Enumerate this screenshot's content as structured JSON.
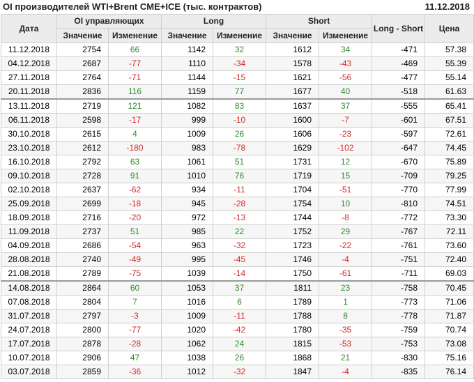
{
  "header": {
    "title": "OI производителей WTI+Brent CME+ICE (тыс. контрактов)",
    "date": "11.12.2018"
  },
  "columns": {
    "date": "Дата",
    "oi_group": "OI управляющих",
    "long_group": "Long",
    "short_group": "Short",
    "long_short": "Long - Short",
    "price": "Цена",
    "value": "Значение",
    "change": "Изменение"
  },
  "colors": {
    "positive": "#2e8b2e",
    "negative": "#d42a2a",
    "header_bg": "#ececec"
  },
  "rows": [
    {
      "date": "11.12.2018",
      "oi": "2754",
      "oi_chg": "66",
      "long": "1142",
      "long_chg": "32",
      "short": "1612",
      "short_chg": "34",
      "ls": "-471",
      "price": "57.38"
    },
    {
      "date": "04.12.2018",
      "oi": "2687",
      "oi_chg": "-77",
      "long": "1110",
      "long_chg": "-34",
      "short": "1578",
      "short_chg": "-43",
      "ls": "-469",
      "price": "55.39"
    },
    {
      "date": "27.11.2018",
      "oi": "2764",
      "oi_chg": "-71",
      "long": "1144",
      "long_chg": "-15",
      "short": "1621",
      "short_chg": "-56",
      "ls": "-477",
      "price": "55.14"
    },
    {
      "date": "20.11.2018",
      "oi": "2836",
      "oi_chg": "116",
      "long": "1159",
      "long_chg": "77",
      "short": "1677",
      "short_chg": "40",
      "ls": "-518",
      "price": "61.63"
    },
    {
      "date": "13.11.2018",
      "oi": "2719",
      "oi_chg": "121",
      "long": "1082",
      "long_chg": "83",
      "short": "1637",
      "short_chg": "37",
      "ls": "-555",
      "price": "65.41"
    },
    {
      "date": "06.11.2018",
      "oi": "2598",
      "oi_chg": "-17",
      "long": "999",
      "long_chg": "-10",
      "short": "1600",
      "short_chg": "-7",
      "ls": "-601",
      "price": "67.51"
    },
    {
      "date": "30.10.2018",
      "oi": "2615",
      "oi_chg": "4",
      "long": "1009",
      "long_chg": "26",
      "short": "1606",
      "short_chg": "-23",
      "ls": "-597",
      "price": "72.61"
    },
    {
      "date": "23.10.2018",
      "oi": "2612",
      "oi_chg": "-180",
      "long": "983",
      "long_chg": "-78",
      "short": "1629",
      "short_chg": "-102",
      "ls": "-647",
      "price": "74.45"
    },
    {
      "date": "16.10.2018",
      "oi": "2792",
      "oi_chg": "63",
      "long": "1061",
      "long_chg": "51",
      "short": "1731",
      "short_chg": "12",
      "ls": "-670",
      "price": "75.89"
    },
    {
      "date": "09.10.2018",
      "oi": "2728",
      "oi_chg": "91",
      "long": "1010",
      "long_chg": "76",
      "short": "1719",
      "short_chg": "15",
      "ls": "-709",
      "price": "79.25"
    },
    {
      "date": "02.10.2018",
      "oi": "2637",
      "oi_chg": "-62",
      "long": "934",
      "long_chg": "-11",
      "short": "1704",
      "short_chg": "-51",
      "ls": "-770",
      "price": "77.99"
    },
    {
      "date": "25.09.2018",
      "oi": "2699",
      "oi_chg": "-18",
      "long": "945",
      "long_chg": "-28",
      "short": "1754",
      "short_chg": "10",
      "ls": "-810",
      "price": "74.51"
    },
    {
      "date": "18.09.2018",
      "oi": "2716",
      "oi_chg": "-20",
      "long": "972",
      "long_chg": "-13",
      "short": "1744",
      "short_chg": "-8",
      "ls": "-772",
      "price": "73.30"
    },
    {
      "date": "11.09.2018",
      "oi": "2737",
      "oi_chg": "51",
      "long": "985",
      "long_chg": "22",
      "short": "1752",
      "short_chg": "29",
      "ls": "-767",
      "price": "72.11"
    },
    {
      "date": "04.09.2018",
      "oi": "2686",
      "oi_chg": "-54",
      "long": "963",
      "long_chg": "-32",
      "short": "1723",
      "short_chg": "-22",
      "ls": "-761",
      "price": "73.60"
    },
    {
      "date": "28.08.2018",
      "oi": "2740",
      "oi_chg": "-49",
      "long": "995",
      "long_chg": "-45",
      "short": "1746",
      "short_chg": "-4",
      "ls": "-751",
      "price": "72.40"
    },
    {
      "date": "21.08.2018",
      "oi": "2789",
      "oi_chg": "-75",
      "long": "1039",
      "long_chg": "-14",
      "short": "1750",
      "short_chg": "-61",
      "ls": "-711",
      "price": "69.03"
    },
    {
      "date": "14.08.2018",
      "oi": "2864",
      "oi_chg": "60",
      "long": "1053",
      "long_chg": "37",
      "short": "1811",
      "short_chg": "23",
      "ls": "-758",
      "price": "70.45"
    },
    {
      "date": "07.08.2018",
      "oi": "2804",
      "oi_chg": "7",
      "long": "1016",
      "long_chg": "6",
      "short": "1789",
      "short_chg": "1",
      "ls": "-773",
      "price": "71.06"
    },
    {
      "date": "31.07.2018",
      "oi": "2797",
      "oi_chg": "-3",
      "long": "1009",
      "long_chg": "-11",
      "short": "1788",
      "short_chg": "8",
      "ls": "-778",
      "price": "71.87"
    },
    {
      "date": "24.07.2018",
      "oi": "2800",
      "oi_chg": "-77",
      "long": "1020",
      "long_chg": "-42",
      "short": "1780",
      "short_chg": "-35",
      "ls": "-759",
      "price": "70.74"
    },
    {
      "date": "17.07.2018",
      "oi": "2878",
      "oi_chg": "-28",
      "long": "1062",
      "long_chg": "24",
      "short": "1815",
      "short_chg": "-53",
      "ls": "-753",
      "price": "73.08"
    },
    {
      "date": "10.07.2018",
      "oi": "2906",
      "oi_chg": "47",
      "long": "1038",
      "long_chg": "26",
      "short": "1868",
      "short_chg": "21",
      "ls": "-830",
      "price": "75.16"
    },
    {
      "date": "03.07.2018",
      "oi": "2859",
      "oi_chg": "-36",
      "long": "1012",
      "long_chg": "-32",
      "short": "1847",
      "short_chg": "-4",
      "ls": "-835",
      "price": "76.14"
    }
  ]
}
